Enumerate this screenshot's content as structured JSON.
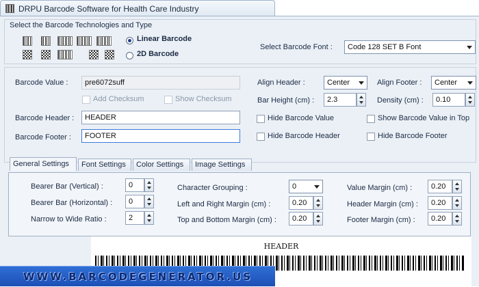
{
  "window": {
    "title": "DRPU Barcode Software for Health Care Industry"
  },
  "technology": {
    "section_label": "Select the Barcode Technologies and Type",
    "linear_label": "Linear Barcode",
    "twod_label": "2D Barcode",
    "selected": "Linear Barcode"
  },
  "font": {
    "label": "Select Barcode Font :",
    "value": "Code 128 SET B Font"
  },
  "value": {
    "label": "Barcode Value :",
    "text": "pre6072suff",
    "add_checksum": "Add Checksum",
    "show_checksum": "Show Checksum"
  },
  "header": {
    "label": "Barcode Header :",
    "text": "HEADER"
  },
  "footer": {
    "label": "Barcode Footer :",
    "text": "FOOTER"
  },
  "align": {
    "header_label": "Align Header :",
    "header_value": "Center",
    "footer_label": "Align Footer :",
    "footer_value": "Center"
  },
  "bar_height": {
    "label": "Bar Height (cm) :",
    "value": "2.3"
  },
  "density": {
    "label": "Density (cm) :",
    "value": "0.10"
  },
  "hide": {
    "barcode_value": "Hide Barcode Value",
    "show_value_top": "Show Barcode Value in Top",
    "barcode_header": "Hide Barcode Header",
    "barcode_footer": "Hide Barcode Footer"
  },
  "tabs": [
    {
      "label": "General Settings"
    },
    {
      "label": "Font Settings"
    },
    {
      "label": "Color Settings"
    },
    {
      "label": "Image Settings"
    }
  ],
  "general": {
    "bearer_v_label": "Bearer Bar (Vertical) :",
    "bearer_v": "0",
    "bearer_h_label": "Bearer Bar (Horizontal) :",
    "bearer_h": "0",
    "ratio_label": "Narrow to Wide Ratio :",
    "ratio": "2",
    "grouping_label": "Character Grouping :",
    "grouping": "0",
    "lr_margin_label": "Left and Right Margin (cm) :",
    "lr_margin": "0.20",
    "tb_margin_label": "Top and Bottom Margin (cm) :",
    "tb_margin": "0.20",
    "value_margin_label": "Value Margin (cm) :",
    "value_margin": "0.20",
    "header_margin_label": "Header Margin (cm) :",
    "header_margin": "0.20",
    "footer_margin_label": "Footer Margin (cm) :",
    "footer_margin": "0.20"
  },
  "preview": {
    "header": "HEADER"
  },
  "banner": {
    "text": "WWW.BARCODEGENERATOR.US"
  }
}
